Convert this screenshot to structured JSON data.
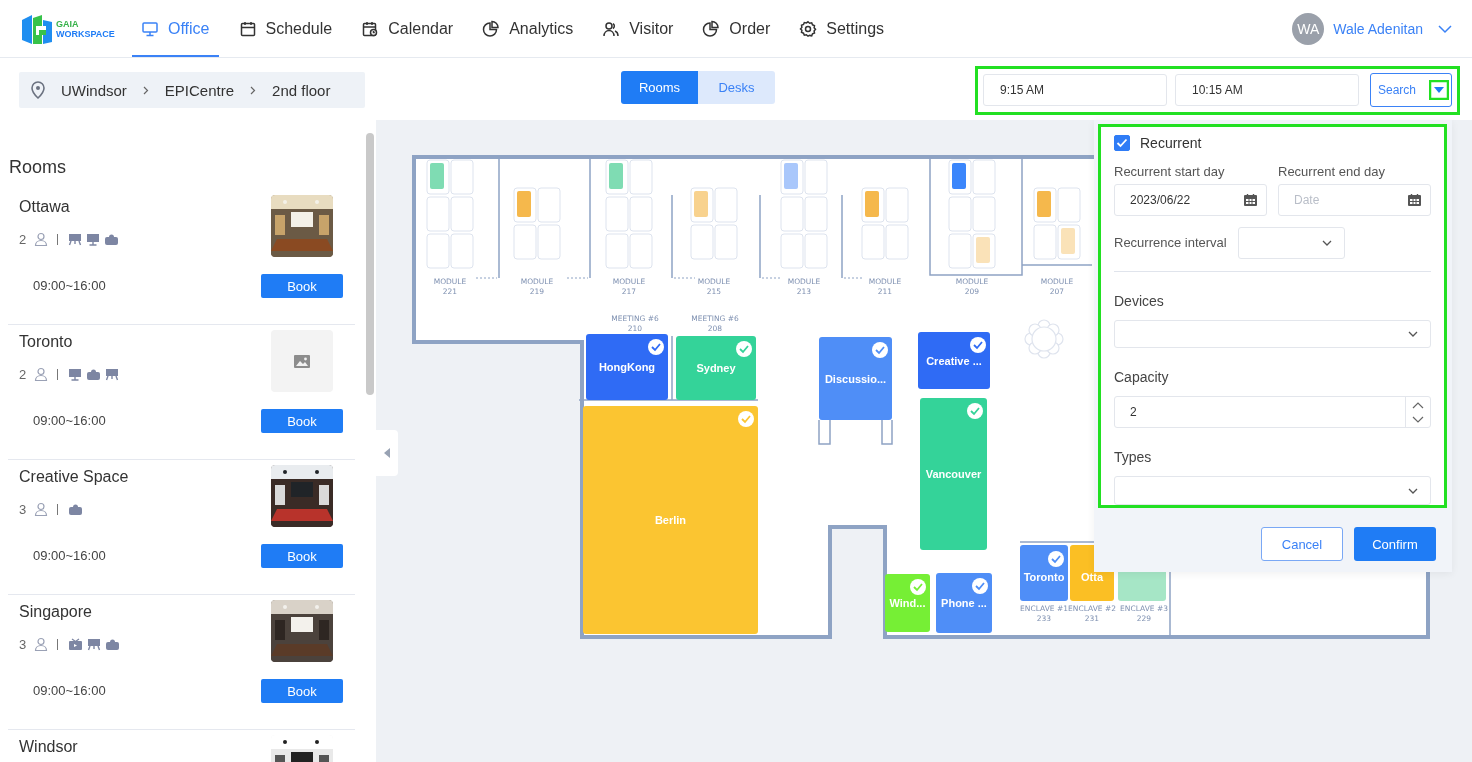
{
  "brand": {
    "line1": "GAIA",
    "line2": "WORKSPACE"
  },
  "nav": [
    {
      "label": "Office",
      "selected": true
    },
    {
      "label": "Schedule",
      "selected": false
    },
    {
      "label": "Calendar",
      "selected": false
    },
    {
      "label": "Analytics",
      "selected": false
    },
    {
      "label": "Visitor",
      "selected": false
    },
    {
      "label": "Order",
      "selected": false
    },
    {
      "label": "Settings",
      "selected": false
    }
  ],
  "user": {
    "initials": "WA",
    "name": "Wale Adenitan"
  },
  "breadcrumb": [
    "UWindsor",
    "EPICentre",
    "2nd floor"
  ],
  "view_toggle": [
    {
      "label": "Rooms",
      "selected": true
    },
    {
      "label": "Desks",
      "selected": false
    }
  ],
  "time_search": {
    "start": "9:15 AM",
    "end": "10:15 AM",
    "button": "Search"
  },
  "rooms_panel": {
    "title": "Rooms",
    "rooms": [
      {
        "name": "Ottawa",
        "capacity": "2",
        "amenities": [
          {
            "kind": "board"
          },
          {
            "kind": "monitor"
          },
          {
            "kind": "projector"
          }
        ],
        "hours": "09:00~16:00",
        "book": "Book",
        "image": {
          "kind": "picture"
        }
      },
      {
        "name": "Toronto",
        "capacity": "2",
        "amenities": [
          {
            "kind": "monitor"
          },
          {
            "kind": "projector"
          },
          {
            "kind": "board"
          }
        ],
        "hours": "09:00~16:00",
        "book": "Book",
        "image": {
          "kind": "placeholder"
        }
      },
      {
        "name": "Creative Space",
        "capacity": "3",
        "amenities": [
          {
            "kind": "projector"
          }
        ],
        "hours": "09:00~16:00",
        "book": "Book",
        "image": {
          "kind": "picture"
        }
      },
      {
        "name": "Singapore",
        "capacity": "3",
        "amenities": [
          {
            "kind": "tv"
          },
          {
            "kind": "board"
          },
          {
            "kind": "projector"
          }
        ],
        "hours": "09:00~16:00",
        "book": "Book",
        "image": {
          "kind": "picture"
        }
      },
      {
        "name": "Windsor",
        "image": {
          "kind": "picture"
        }
      }
    ]
  },
  "floor_plan": {
    "modules": [
      {
        "label": "MODULE",
        "number": "221",
        "seats": [
          {
            "occupied": true,
            "color": "#7fdcb3"
          },
          {
            "occupied": false
          },
          {
            "occupied": false
          },
          {
            "occupied": false
          },
          {
            "occupied": false
          },
          {
            "occupied": false
          }
        ]
      },
      {
        "label": "MODULE",
        "number": "219",
        "seats": [
          {
            "occupied": true,
            "color": "#f5b84c"
          },
          {
            "occupied": false
          },
          {
            "occupied": false
          },
          {
            "occupied": false
          }
        ]
      },
      {
        "label": "MODULE",
        "number": "217",
        "seats": [
          {
            "occupied": true,
            "color": "#7fdcb3"
          },
          {
            "occupied": false
          },
          {
            "occupied": false
          },
          {
            "occupied": false
          },
          {
            "occupied": false
          },
          {
            "occupied": false
          }
        ]
      },
      {
        "label": "MODULE",
        "number": "215",
        "seats": [
          {
            "occupied": true,
            "color": "#f8d28e"
          },
          {
            "occupied": false
          },
          {
            "occupied": false
          },
          {
            "occupied": false
          }
        ]
      },
      {
        "label": "MODULE",
        "number": "213",
        "seats": [
          {
            "occupied": true,
            "color": "#a9c7fb"
          },
          {
            "occupied": false
          },
          {
            "occupied": false
          },
          {
            "occupied": false
          },
          {
            "occupied": false
          },
          {
            "occupied": false
          }
        ]
      },
      {
        "label": "MODULE",
        "number": "211",
        "seats": [
          {
            "occupied": true,
            "color": "#f5b84c"
          },
          {
            "occupied": false
          },
          {
            "occupied": false
          },
          {
            "occupied": false
          }
        ]
      },
      {
        "label": "MODULE",
        "number": "209",
        "seats": [
          {
            "occupied": true,
            "color": "#3b86fb"
          },
          {
            "occupied": false
          },
          {
            "occupied": false
          },
          {
            "occupied": false
          },
          {
            "occupied": false
          },
          {
            "occupied": true,
            "color": "#fae2b8"
          }
        ]
      },
      {
        "label": "MODULE",
        "number": "207",
        "seats": [
          {
            "occupied": true,
            "color": "#f5b84c"
          },
          {
            "occupied": false
          },
          {
            "occupied": false
          },
          {
            "occupied": true,
            "color": "#fae2b8"
          }
        ]
      }
    ],
    "room_labels": [
      {
        "line1": "MEETING #6",
        "line2": "210"
      },
      {
        "line1": "MEETING #6",
        "line2": "208"
      }
    ],
    "rooms": [
      {
        "name": "HongKong",
        "color": "#2f6bf5"
      },
      {
        "name": "Sydney",
        "color": "#34d399"
      },
      {
        "name": "Berlin",
        "color": "#fbc531"
      },
      {
        "name": "Discussio...",
        "color": "#4f8ef7"
      },
      {
        "name": "Creative ...",
        "color": "#2f6bf5"
      },
      {
        "name": "Vancouver",
        "color": "#34d399"
      },
      {
        "name": "Wind...",
        "color": "#76ef35"
      },
      {
        "name": "Phone ...",
        "color": "#4f8ef7"
      },
      {
        "name": "Toronto",
        "color": "#4f8ef7"
      },
      {
        "name": "Otta",
        "color": "#fbbf24"
      },
      {
        "color": "#a6e6c6"
      }
    ],
    "enclave_labels": [
      {
        "line1": "ENCLAVE #1",
        "line2": "233"
      },
      {
        "line1": "ENCLAVE #2",
        "line2": "231"
      },
      {
        "line1": "ENCLAVE #3",
        "line2": "229"
      }
    ]
  },
  "filter_panel": {
    "recurrent": {
      "label": "Recurrent",
      "checked": true
    },
    "start_day": {
      "label": "Recurrent start day",
      "value": "2023/06/22"
    },
    "end_day": {
      "label": "Recurrent end day",
      "placeholder": "Date"
    },
    "interval": {
      "label": "Recurrence interval"
    },
    "devices": {
      "label": "Devices"
    },
    "capacity": {
      "label": "Capacity",
      "value": "2"
    },
    "types": {
      "label": "Types"
    },
    "buttons": [
      "Cancel",
      "Confirm"
    ]
  }
}
